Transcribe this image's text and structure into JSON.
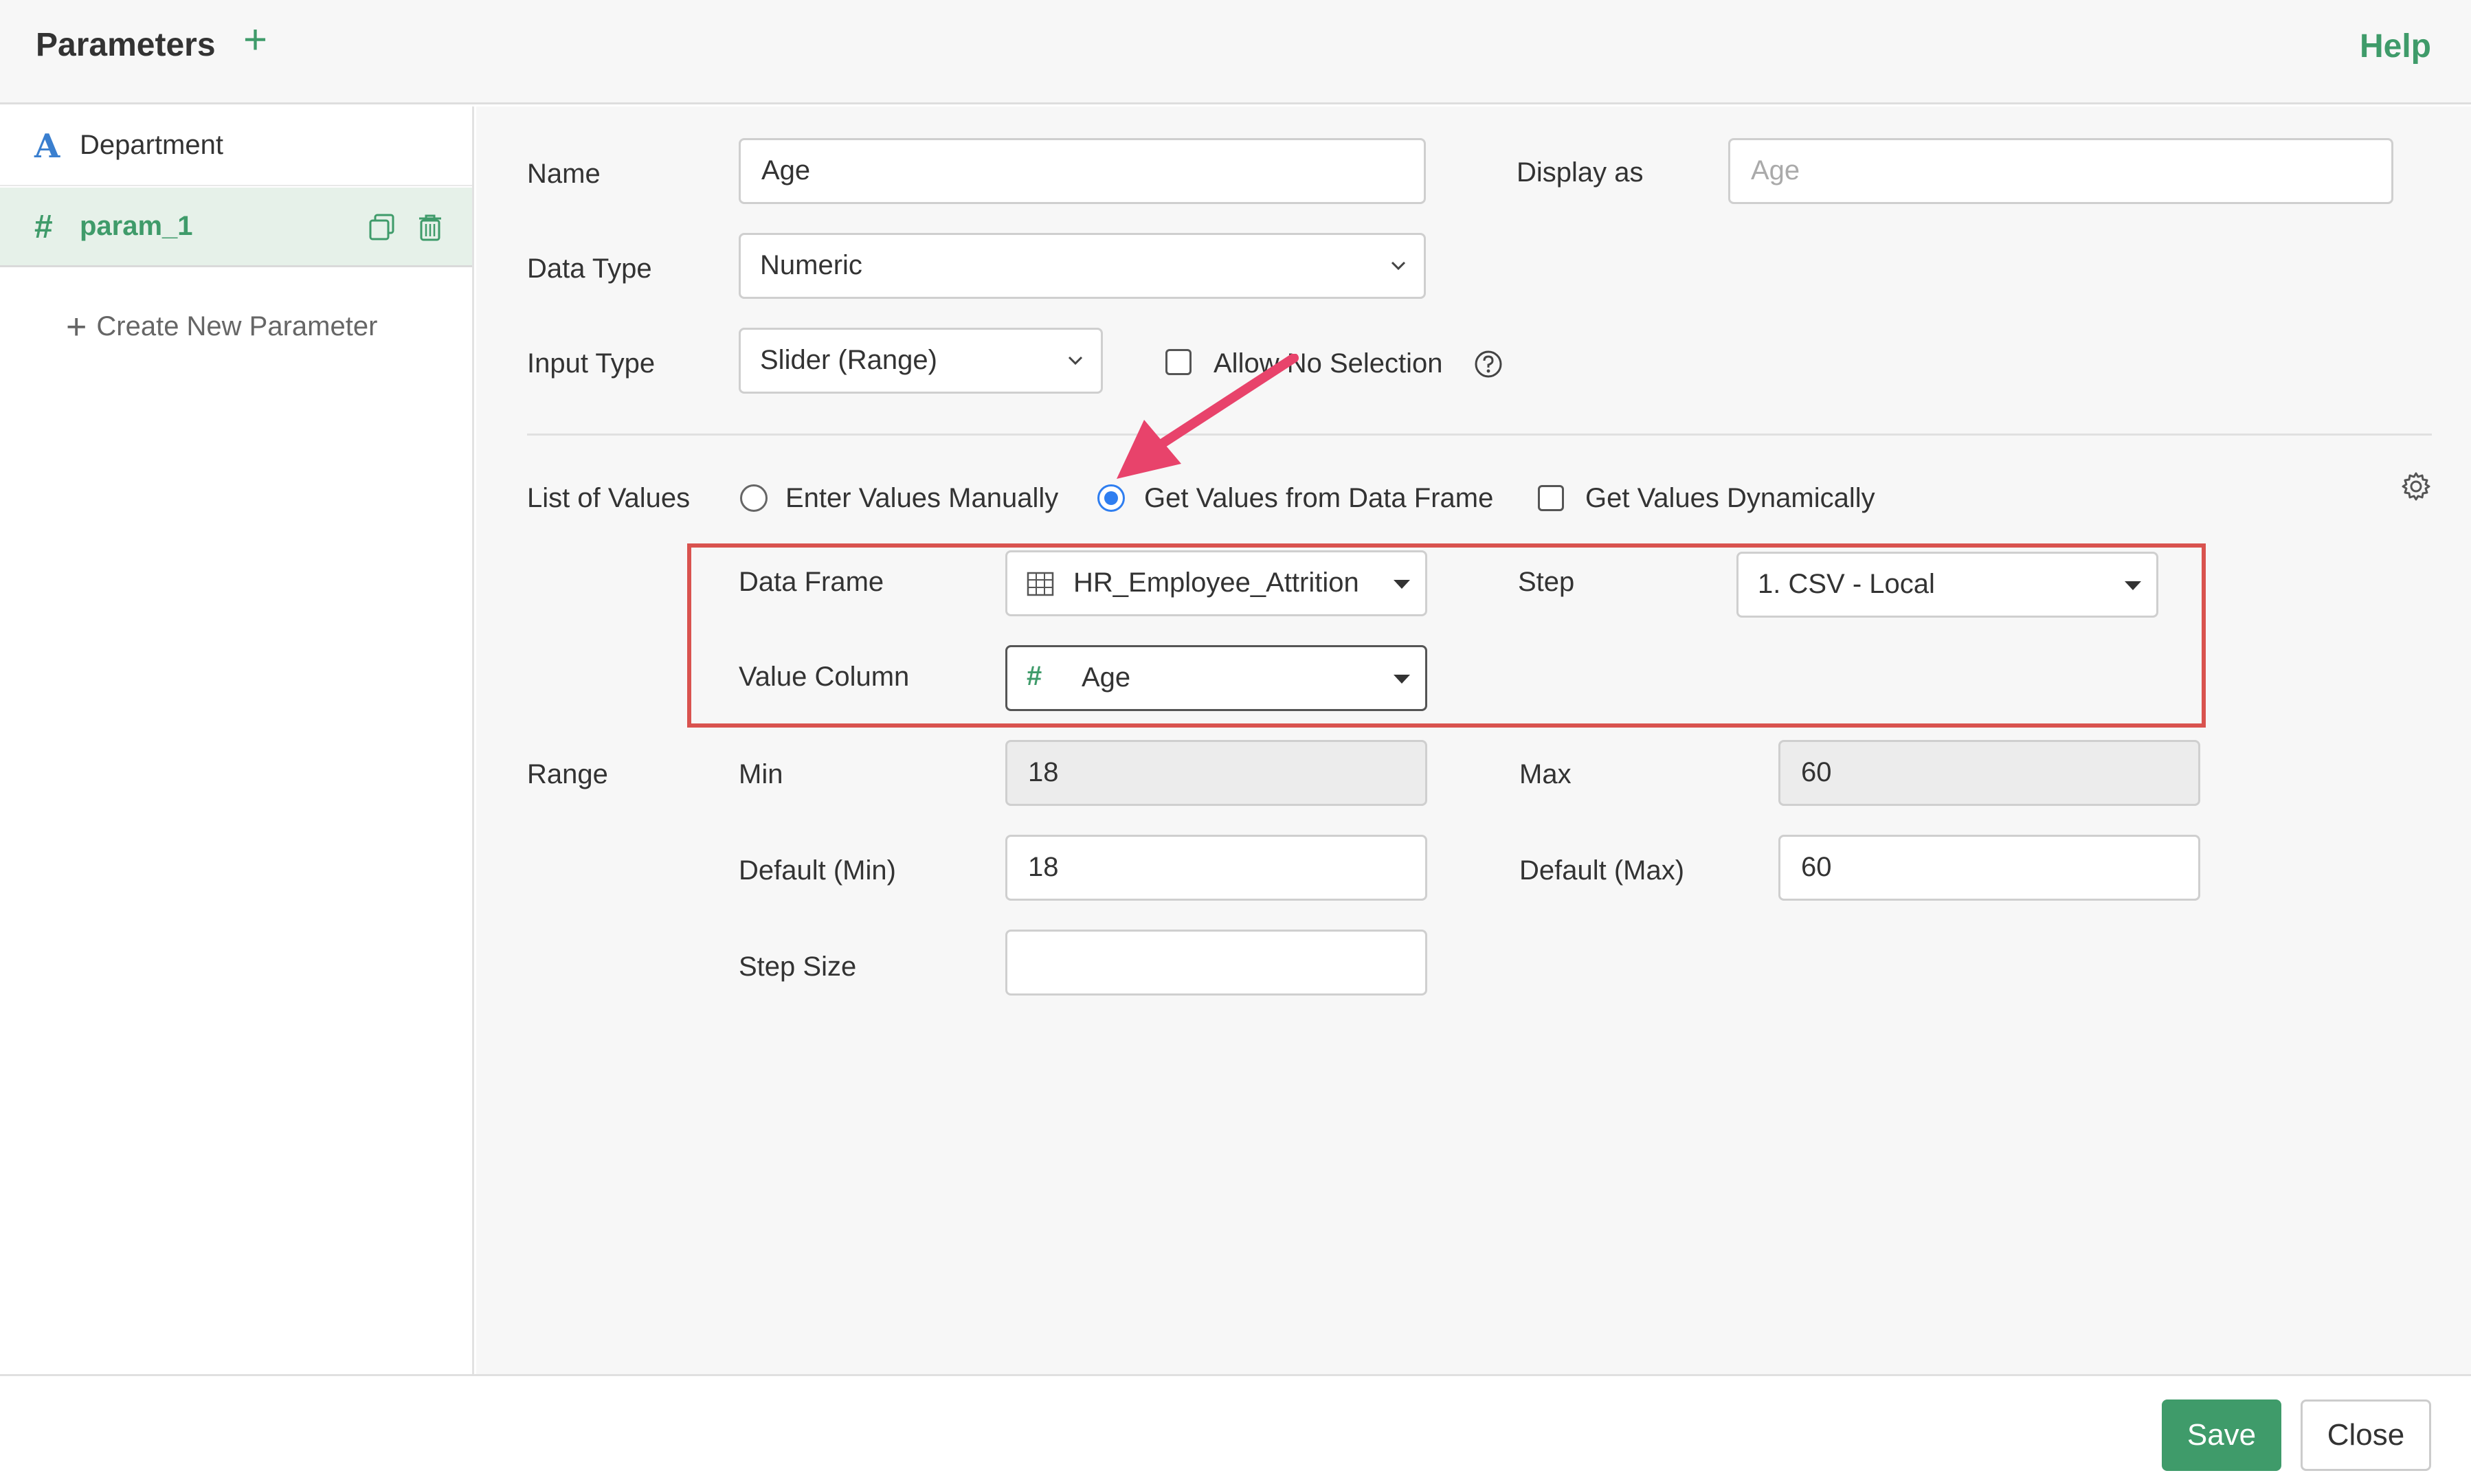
{
  "header": {
    "title": "Parameters",
    "help": "Help"
  },
  "sidebar": {
    "items": [
      {
        "label": "Department",
        "type_icon": "A"
      },
      {
        "label": "param_1",
        "type_icon": "#"
      }
    ],
    "create_new": "Create New Parameter"
  },
  "form": {
    "name_label": "Name",
    "name_value": "Age",
    "display_as_label": "Display as",
    "display_as_placeholder": "Age",
    "data_type_label": "Data Type",
    "data_type_value": "Numeric",
    "input_type_label": "Input Type",
    "input_type_value": "Slider (Range)",
    "allow_no_selection": "Allow No Selection",
    "list_of_values_label": "List of Values",
    "options": {
      "manual": "Enter Values Manually",
      "data_frame": "Get Values from Data Frame",
      "dynamic": "Get Values Dynamically"
    },
    "data_frame_label": "Data Frame",
    "data_frame_value": "HR_Employee_Attrition",
    "step_label": "Step",
    "step_value": "1. CSV - Local",
    "value_column_label": "Value Column",
    "value_column_value": "Age",
    "range_label": "Range",
    "min_label": "Min",
    "min_value": "18",
    "max_label": "Max",
    "max_value": "60",
    "default_min_label": "Default (Min)",
    "default_min_value": "18",
    "default_max_label": "Default (Max)",
    "default_max_value": "60",
    "step_size_label": "Step Size",
    "step_size_value": ""
  },
  "footer": {
    "save": "Save",
    "close": "Close"
  },
  "colors": {
    "accent": "#3f9b6a",
    "highlight": "#d9534f",
    "arrow": "#e8436b",
    "radio": "#2f7ef0"
  }
}
